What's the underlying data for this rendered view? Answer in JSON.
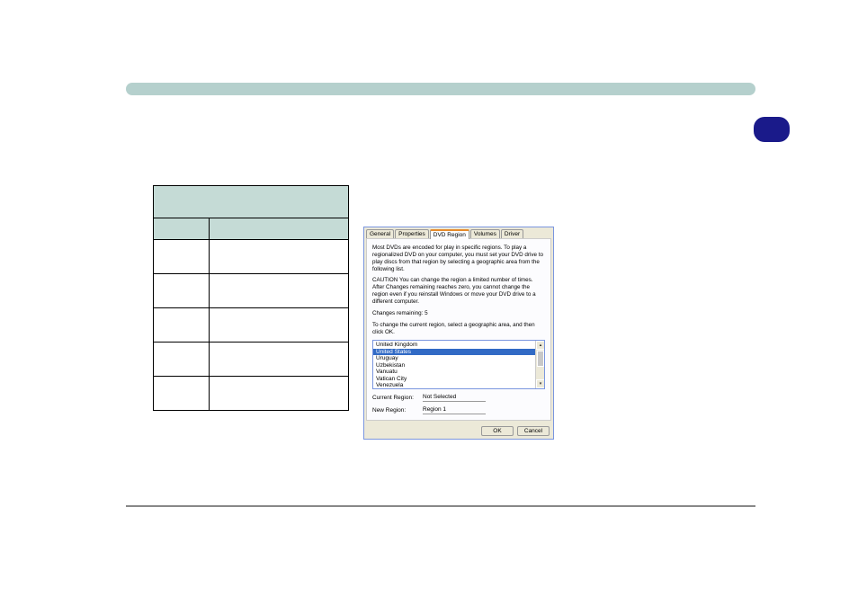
{
  "dialog": {
    "tabs": [
      "General",
      "Properties",
      "DVD Region",
      "Volumes",
      "Driver"
    ],
    "active_tab": "DVD Region",
    "intro_text": "Most DVDs are encoded for play in specific regions. To play a regionalized DVD on your computer, you must set your DVD drive to play discs from that region by selecting a geographic area from the following list.",
    "caution_text": "CAUTION   You can change the region a limited number of times. After Changes remaining reaches zero, you cannot change the region even if you reinstall Windows or move your DVD drive to a different computer.",
    "changes_remaining": "Changes remaining: 5",
    "instruction": "To change the current region, select a geographic area, and then click OK.",
    "countries": [
      "United Kingdom",
      "United States",
      "Uruguay",
      "Uzbekistan",
      "Vanuatu",
      "Vatican City",
      "Venezuela"
    ],
    "selected_index": 1,
    "current_region_label": "Current Region:",
    "current_region_value": "Not Selected",
    "new_region_label": "New Region:",
    "new_region_value": "Region 1",
    "ok_label": "OK",
    "cancel_label": "Cancel"
  }
}
